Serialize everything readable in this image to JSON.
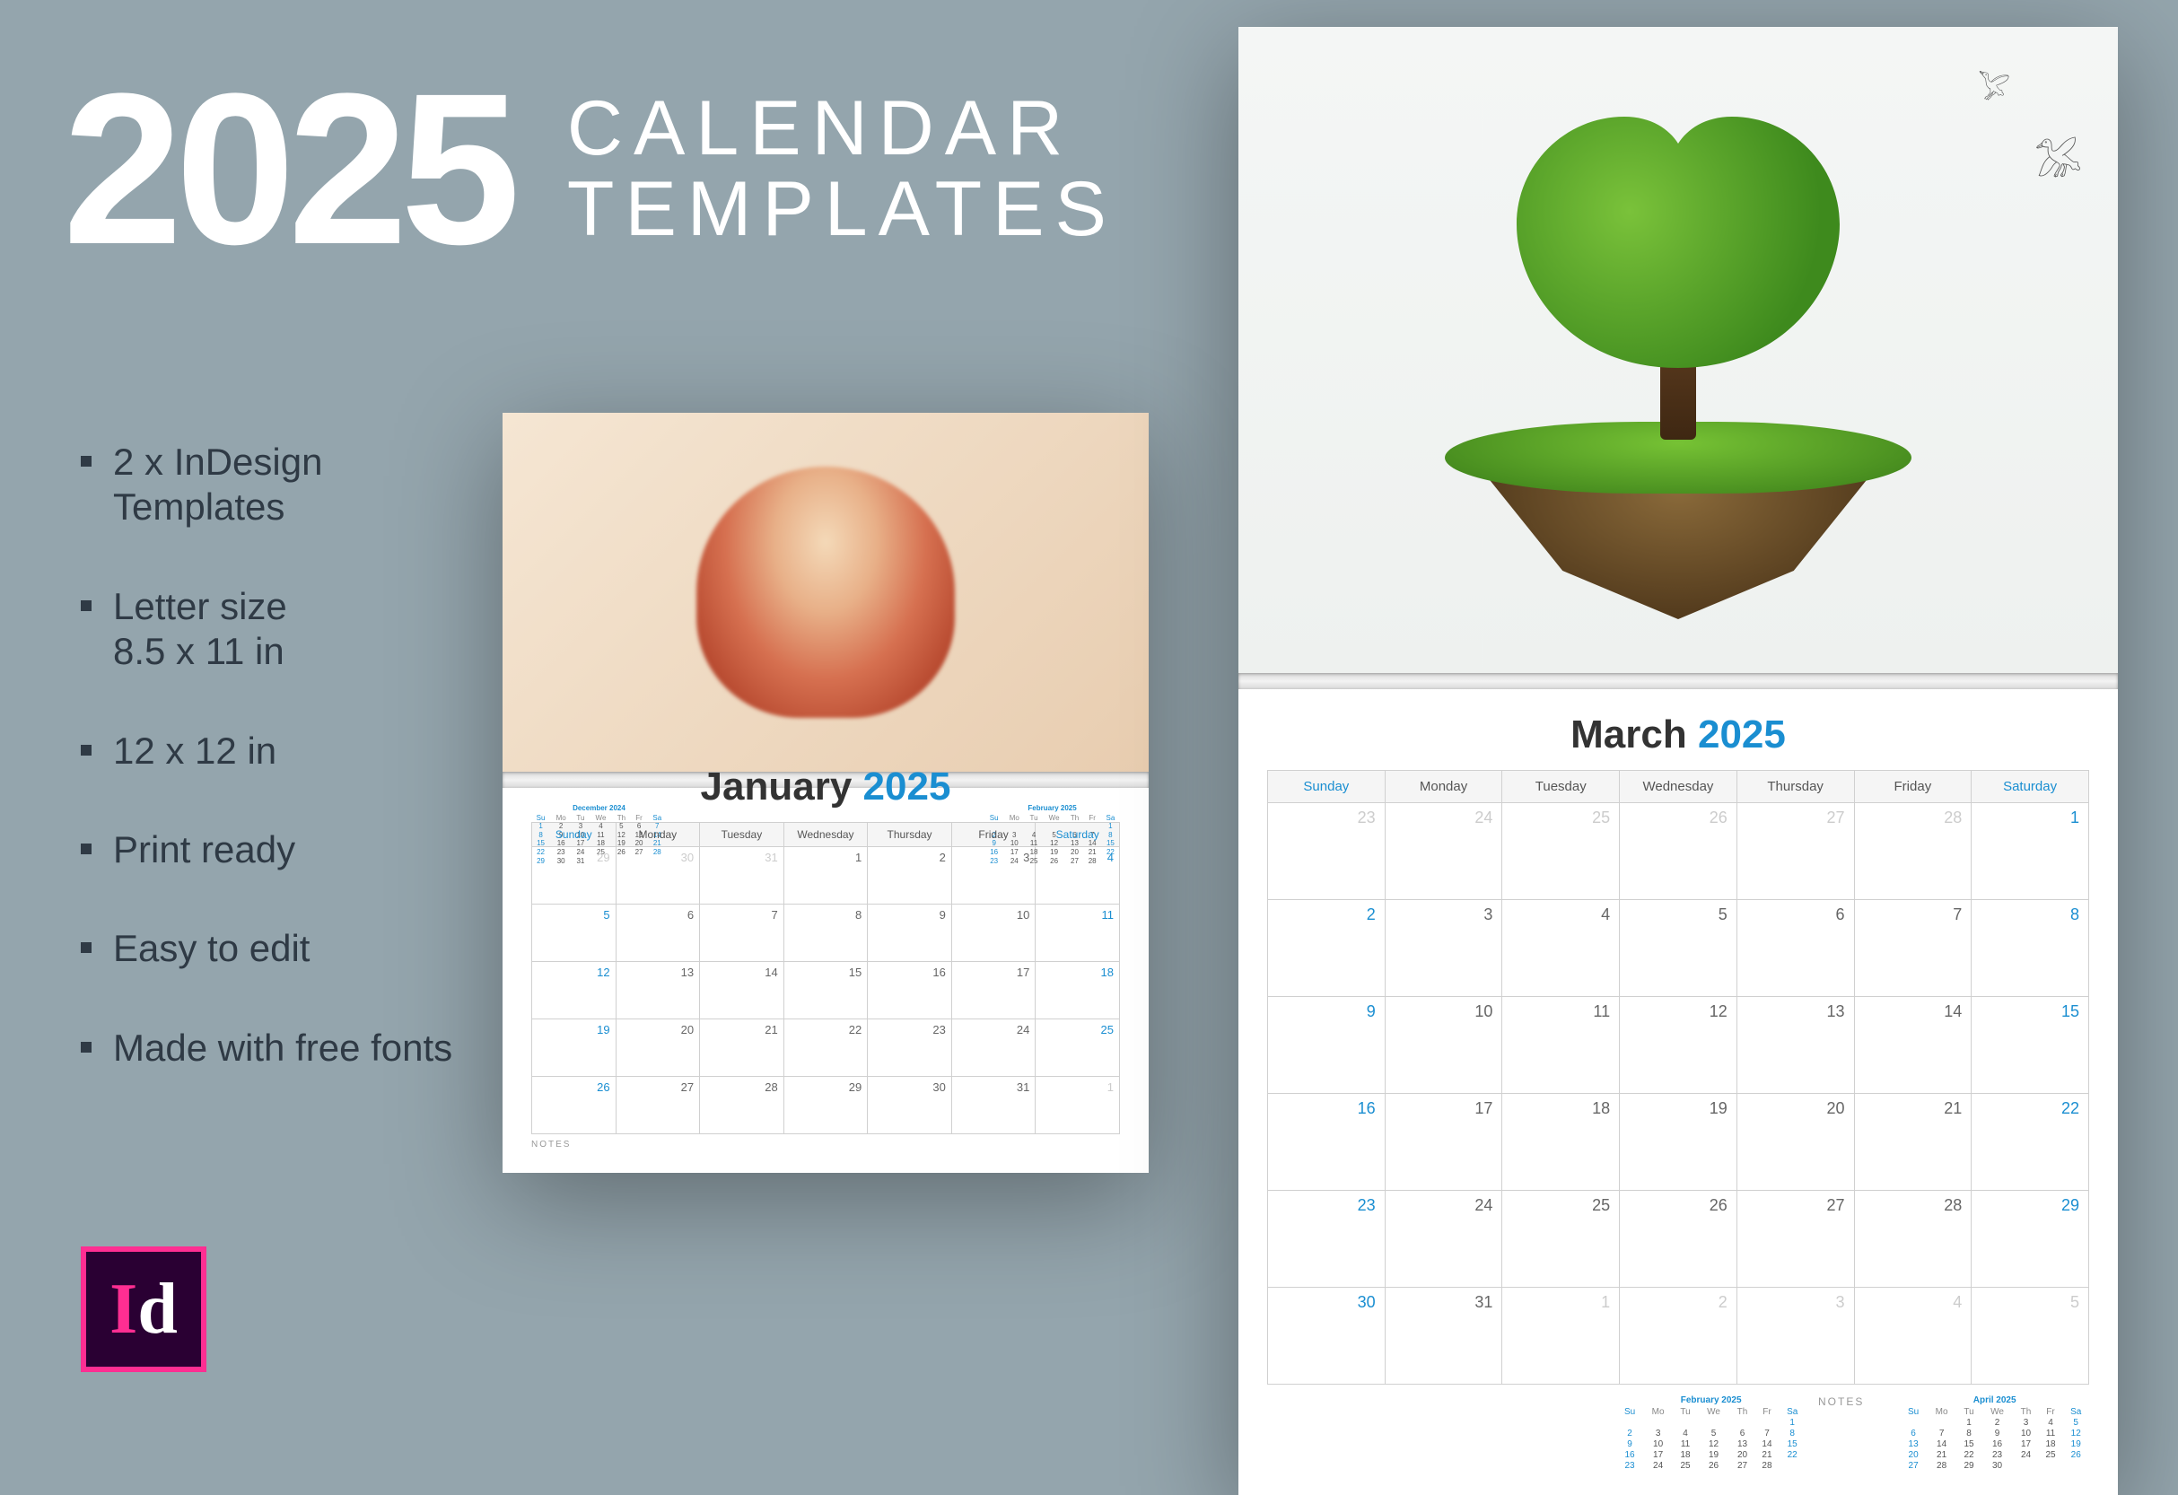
{
  "headline": {
    "year": "2025",
    "line1": "CALENDAR",
    "line2": "TEMPLATES"
  },
  "features": [
    "2 x InDesign Templates",
    "Letter size 8.5 x 11 in",
    "12 x 12 in",
    "Print ready",
    "Easy to edit",
    "Made with free fonts"
  ],
  "badge": {
    "id": "Id"
  },
  "days_full": [
    "Sunday",
    "Monday",
    "Tuesday",
    "Wednesday",
    "Thursday",
    "Friday",
    "Saturday"
  ],
  "days_short": [
    "Su",
    "Mo",
    "Tu",
    "We",
    "Th",
    "Fr",
    "Sa"
  ],
  "notes_label": "NOTES",
  "cal_a": {
    "month": "January",
    "year": "2025",
    "mini_prev": {
      "title": "December 2024",
      "first_dow": 0,
      "days": 31
    },
    "mini_next": {
      "title": "February 2025",
      "first_dow": 6,
      "days": 28
    },
    "grid": {
      "first_dow": 3,
      "days": 31,
      "prev_days": 31,
      "rows": 5
    }
  },
  "cal_b": {
    "month": "March",
    "year": "2025",
    "mini_prev": {
      "title": "February 2025",
      "first_dow": 6,
      "days": 28
    },
    "mini_next": {
      "title": "April 2025",
      "first_dow": 2,
      "days": 30
    },
    "grid": {
      "first_dow": 6,
      "days": 31,
      "prev_days": 28,
      "rows": 6
    }
  }
}
